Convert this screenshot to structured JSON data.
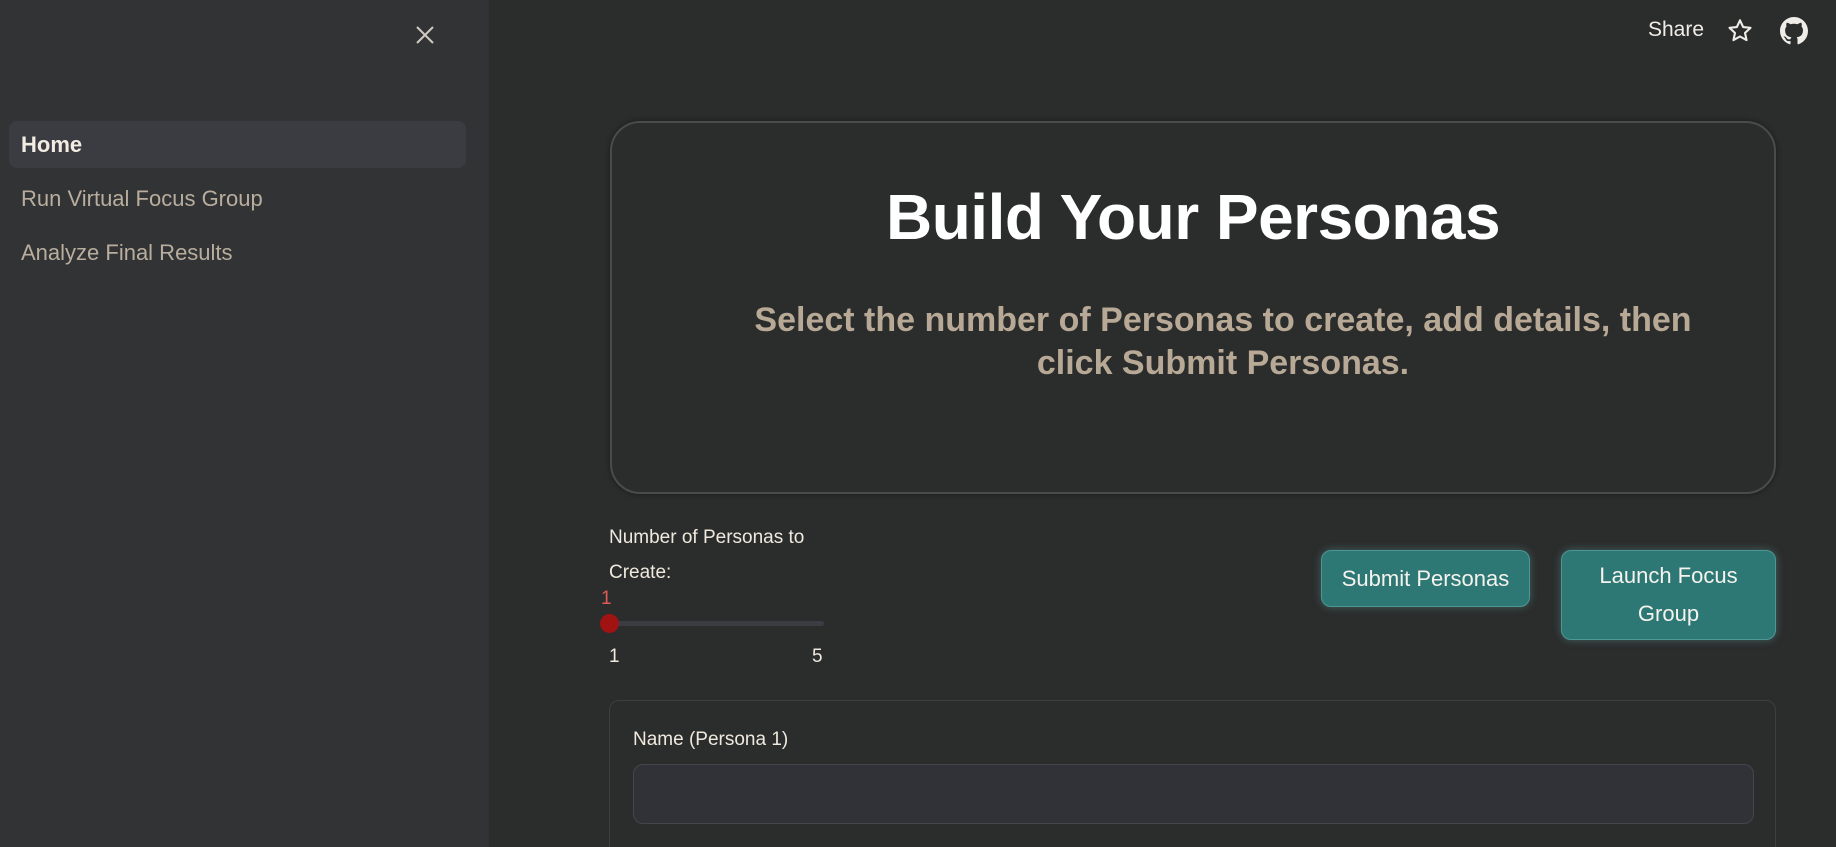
{
  "sidebar": {
    "items": [
      {
        "label": "Home",
        "active": true
      },
      {
        "label": "Run Virtual Focus Group",
        "active": false
      },
      {
        "label": "Analyze Final Results",
        "active": false
      }
    ],
    "close_icon": "close-icon"
  },
  "topbar": {
    "share_label": "Share",
    "star_icon": "star-icon",
    "github_icon": "github-icon"
  },
  "hero": {
    "title": "Build Your Personas",
    "subtitle": "Select the number of Personas to create, add details, then click Submit Personas."
  },
  "slider": {
    "label": "Number of Personas to Create:",
    "value": "1",
    "min": "1",
    "max": "5"
  },
  "buttons": {
    "submit_label": "Submit Personas",
    "launch_label": "Launch Focus Group"
  },
  "form": {
    "name_label": "Name (Persona 1)",
    "name_value": "",
    "name_placeholder": ""
  },
  "colors": {
    "background": "#2b2c2c",
    "sidebar": "#323335",
    "accent_button": "#2d7775",
    "slider_thumb": "#a11212",
    "slider_value": "#e25a57"
  }
}
